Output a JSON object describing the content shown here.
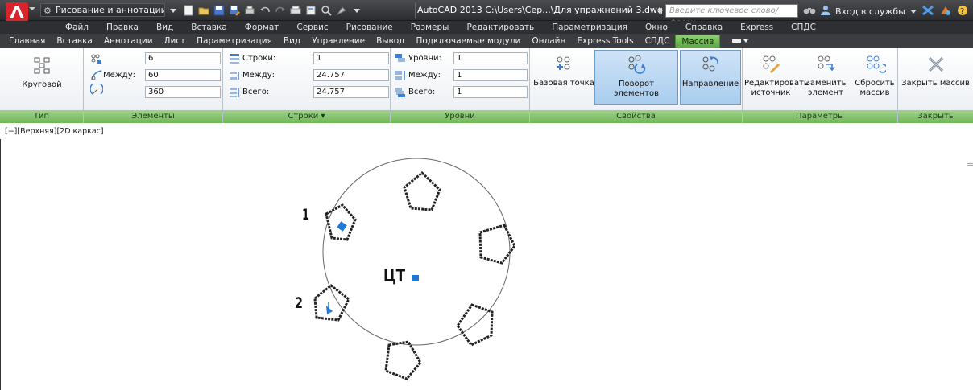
{
  "titlebar": {
    "workspace": "Рисование и аннотации",
    "title": "AutoCAD 2013   C:\\Users\\Сер...\\Для упражнений 3.dwg",
    "search_placeholder": "Введите ключевое слово/фразу",
    "signin": "Вход в службы",
    "colors": {
      "bar": "#2c2d30",
      "app_logo": "#d9242a"
    }
  },
  "menubar": {
    "items": [
      "Файл",
      "Правка",
      "Вид",
      "Вставка",
      "Формат",
      "Сервис",
      "Рисование",
      "Размеры",
      "Редактировать",
      "Параметризация",
      "Окно",
      "Справка",
      "Express",
      "СПДС"
    ]
  },
  "ribbon_tabs": {
    "items": [
      "Главная",
      "Вставка",
      "Аннотации",
      "Лист",
      "Параметризация",
      "Вид",
      "Управление",
      "Вывод",
      "Подключаемые модули",
      "Онлайн",
      "Express Tools",
      "СПДС"
    ],
    "active": "Массив"
  },
  "panels": {
    "type": {
      "title": "Тип",
      "button": "Круговой"
    },
    "elements": {
      "title": "Элементы",
      "between_label": "Между:",
      "count_value": "6",
      "between_value": "60",
      "fill_value": "360"
    },
    "rows": {
      "title": "Строки ▾",
      "rows_label": "Строки:",
      "between_label": "Между:",
      "total_label": "Всего:",
      "rows_value": "1",
      "between_value": "24.757",
      "total_value": "24.757"
    },
    "levels": {
      "title": "Уровни",
      "levels_label": "Уровни:",
      "between_label": "Между:",
      "total_label": "Всего:",
      "levels_value": "1",
      "between_value": "1",
      "total_value": "1"
    },
    "properties": {
      "title": "Свойства",
      "base_point": "Базовая точка",
      "rotate_items": "Поворот элементов",
      "direction": "Направление"
    },
    "options": {
      "title": "Параметры",
      "edit_source_1": "Редактировать",
      "edit_source_2": "источник",
      "replace_item_1": "Заменить",
      "replace_item_2": "элемент",
      "reset_array_1": "Сбросить",
      "reset_array_2": "массив"
    },
    "close": {
      "title": "Закрыть",
      "button": "Закрыть массив"
    },
    "colors": {
      "panel_title_bg": "#6fb756",
      "highlight": "#a9cdee",
      "accent_blue": "#1e78d7"
    }
  },
  "viewport": {
    "label": "[−][Верхняя][2D каркас]",
    "center_label": "ЦТ",
    "marker_1": "1",
    "marker_2": "2",
    "grip_color": "#1e78d7"
  }
}
